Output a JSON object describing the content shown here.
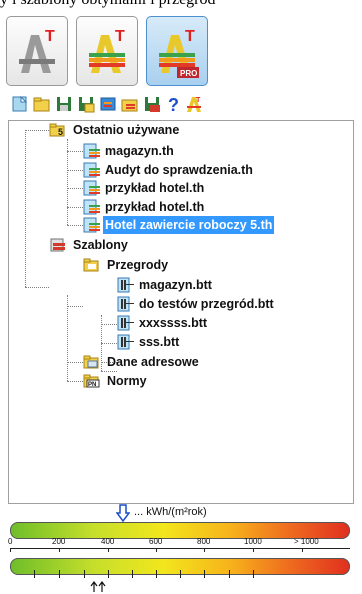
{
  "caption": "y i szablony obtymalni i przegrod",
  "app_buttons": [
    {
      "name": "basic",
      "badge": "T"
    },
    {
      "name": "standard",
      "badge": "T"
    },
    {
      "name": "pro",
      "badge": "T",
      "sub": "PRO"
    }
  ],
  "tree": {
    "recent": {
      "label": "Ostatnio używane",
      "items": [
        "magazyn.th",
        "Audyt do sprawdzenia.th",
        "przykład hotel.th",
        "przykład hotel.th",
        "Hotel zawiercie roboczy 5.th"
      ],
      "selected_index": 4
    },
    "templates": {
      "label": "Szablony",
      "partitions": {
        "label": "Przegrody",
        "items": [
          "magazyn.btt",
          "do testów przegród.btt",
          "xxxssss.btt",
          "sss.btt"
        ]
      },
      "addresses_label": "Dane adresowe",
      "norms_label": "Normy",
      "norms_badge": "PN"
    }
  },
  "meter": {
    "unit": "... kWh/(m²rok)",
    "ticks": [
      "0",
      "200",
      "400",
      "600",
      "800",
      "1000",
      "> 1000"
    ],
    "indicator_value": 300
  }
}
